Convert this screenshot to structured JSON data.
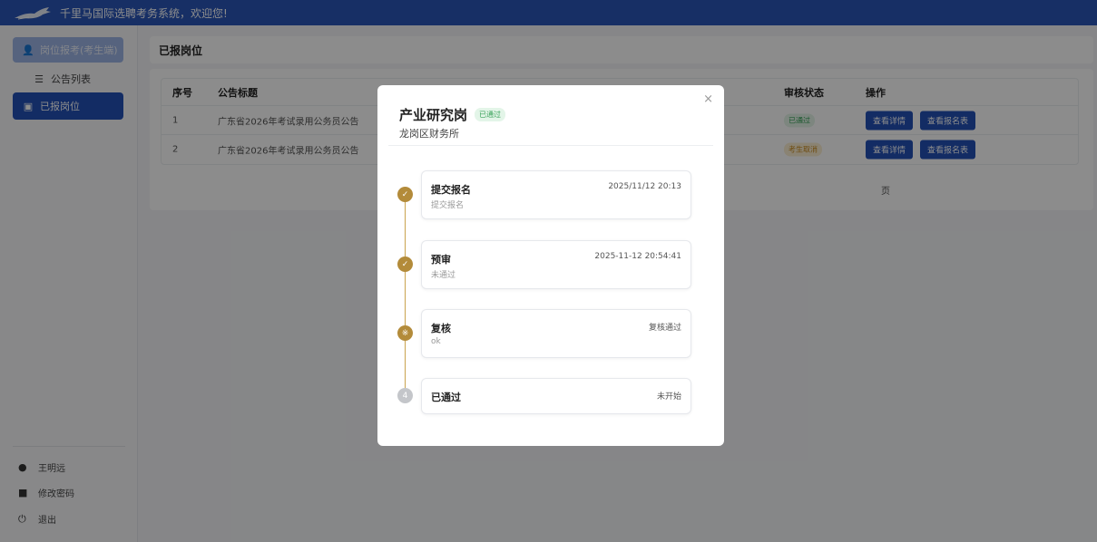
{
  "header": {
    "title": "千里马国际选聘考务系统，欢迎您!"
  },
  "sidebar": {
    "items": [
      {
        "label": "岗位报考(考生端)",
        "icon": "user-icon"
      },
      {
        "label": "公告列表",
        "icon": "list-icon"
      },
      {
        "label": "已报岗位",
        "icon": "id-card-icon"
      }
    ],
    "bottom": [
      {
        "label": "王明远",
        "icon": "account-icon"
      },
      {
        "label": "修改密码",
        "icon": "lock-icon"
      },
      {
        "label": "退出",
        "icon": "power-icon"
      }
    ]
  },
  "page": {
    "title": "已报岗位"
  },
  "table": {
    "headers": {
      "seq": "序号",
      "title": "公告标题",
      "status": "审核状态",
      "op": "操作"
    },
    "rows": [
      {
        "seq": "1",
        "title": "广东省2026年考试录用公务员公告",
        "status": "已通过",
        "status_color": "#3aa25a"
      },
      {
        "seq": "2",
        "title": "广东省2026年考试录用公务员公告",
        "status": "考生取消",
        "status_color": "#c98a1d"
      }
    ],
    "actions": {
      "detail": "查看详情",
      "form": "查看报名表"
    },
    "pager_suffix": "页"
  },
  "modal": {
    "title": "产业研究岗",
    "badge": "已通过",
    "subtitle": "龙岗区财务所",
    "close": "×",
    "steps": [
      {
        "name": "提交报名",
        "right": "2025/11/12 20:13",
        "desc": "提交报名",
        "state": "done",
        "marker": "✓"
      },
      {
        "name": "预审",
        "right": "2025-11-12 20:54:41",
        "desc": "未通过",
        "state": "done",
        "marker": "✓"
      },
      {
        "name": "复核",
        "right": "复核通过",
        "desc": "ok",
        "state": "done",
        "marker": "※"
      },
      {
        "name": "已通过",
        "right": "未开始",
        "desc": "",
        "state": "pending",
        "marker": "4"
      }
    ]
  },
  "colors": {
    "primary": "#2451b6",
    "topbar": "#2b56b8",
    "timeline": "#b38b3a",
    "success": "#3aa25a"
  }
}
